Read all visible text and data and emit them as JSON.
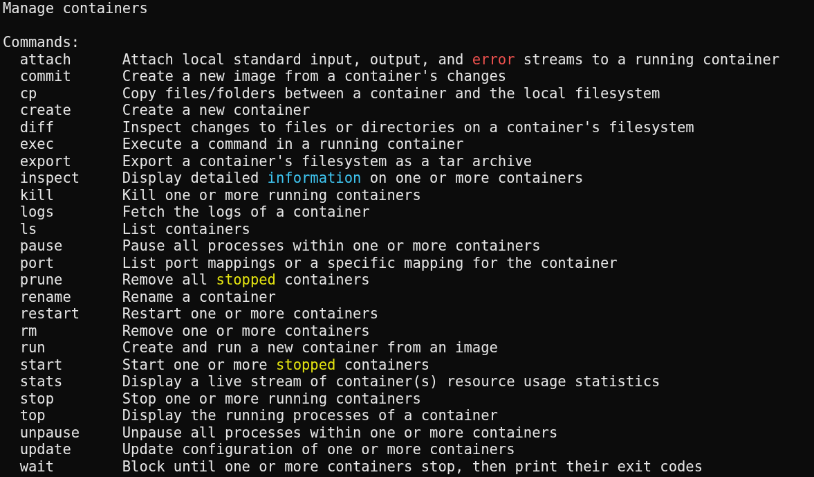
{
  "heading": "Manage containers",
  "section": "Commands:",
  "commands": [
    {
      "name": "attach",
      "description": [
        {
          "text": "Attach local standard input, output, and "
        },
        {
          "text": "error",
          "color": "#f0524f"
        },
        {
          "text": " streams to a running container"
        }
      ]
    },
    {
      "name": "commit",
      "description": [
        {
          "text": "Create a new image from a container's changes"
        }
      ]
    },
    {
      "name": "cp",
      "description": [
        {
          "text": "Copy files/folders between a container and the local filesystem"
        }
      ]
    },
    {
      "name": "create",
      "description": [
        {
          "text": "Create a new container"
        }
      ]
    },
    {
      "name": "diff",
      "description": [
        {
          "text": "Inspect changes to files or directories on a container's filesystem"
        }
      ]
    },
    {
      "name": "exec",
      "description": [
        {
          "text": "Execute a command in a running container"
        }
      ]
    },
    {
      "name": "export",
      "description": [
        {
          "text": "Export a container's filesystem as a tar archive"
        }
      ]
    },
    {
      "name": "inspect",
      "description": [
        {
          "text": "Display detailed "
        },
        {
          "text": "information",
          "color": "#3fc5f0"
        },
        {
          "text": " on one or more containers"
        }
      ]
    },
    {
      "name": "kill",
      "description": [
        {
          "text": "Kill one or more running containers"
        }
      ]
    },
    {
      "name": "logs",
      "description": [
        {
          "text": "Fetch the logs of a container"
        }
      ]
    },
    {
      "name": "ls",
      "description": [
        {
          "text": "List containers"
        }
      ]
    },
    {
      "name": "pause",
      "description": [
        {
          "text": "Pause all processes within one or more containers"
        }
      ]
    },
    {
      "name": "port",
      "description": [
        {
          "text": "List port mappings or a specific mapping for the container"
        }
      ]
    },
    {
      "name": "prune",
      "description": [
        {
          "text": "Remove all "
        },
        {
          "text": "stopped",
          "color": "#e5e510"
        },
        {
          "text": " containers"
        }
      ]
    },
    {
      "name": "rename",
      "description": [
        {
          "text": "Rename a container"
        }
      ]
    },
    {
      "name": "restart",
      "description": [
        {
          "text": "Restart one or more containers"
        }
      ]
    },
    {
      "name": "rm",
      "description": [
        {
          "text": "Remove one or more containers"
        }
      ]
    },
    {
      "name": "run",
      "description": [
        {
          "text": "Create and run a new container from an image"
        }
      ]
    },
    {
      "name": "start",
      "description": [
        {
          "text": "Start one or more "
        },
        {
          "text": "stopped",
          "color": "#e5e510"
        },
        {
          "text": " containers"
        }
      ]
    },
    {
      "name": "stats",
      "description": [
        {
          "text": "Display a live stream of container(s) resource usage statistics"
        }
      ]
    },
    {
      "name": "stop",
      "description": [
        {
          "text": "Stop one or more running containers"
        }
      ]
    },
    {
      "name": "top",
      "description": [
        {
          "text": "Display the running processes of a container"
        }
      ]
    },
    {
      "name": "unpause",
      "description": [
        {
          "text": "Unpause all processes within one or more containers"
        }
      ]
    },
    {
      "name": "update",
      "description": [
        {
          "text": "Update configuration of one or more containers"
        }
      ]
    },
    {
      "name": "wait",
      "description": [
        {
          "text": "Block until one or more containers stop, then print their exit codes"
        }
      ]
    }
  ]
}
